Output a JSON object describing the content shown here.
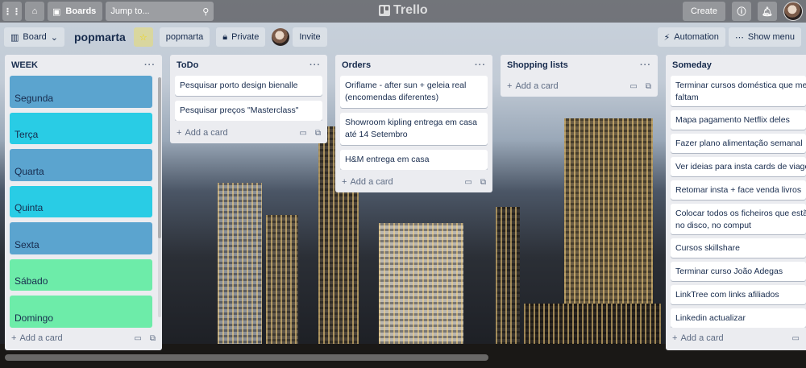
{
  "topbar": {
    "boards_label": "Boards",
    "search_placeholder": "Jump to...",
    "logo_text": "Trello",
    "create_label": "Create"
  },
  "board": {
    "view_label": "Board",
    "name": "popmarta",
    "workspace_label": "popmarta",
    "visibility_label": "Private",
    "invite_label": "Invite",
    "automation_label": "Automation",
    "show_menu_label": "Show menu"
  },
  "colors": {
    "blue_card": "#5ba4cf",
    "sky_card": "#29cce5",
    "green_card": "#6deca9",
    "list_bg": "#ebecf0"
  },
  "lists": [
    {
      "title": "WEEK",
      "add_label": "Add a card",
      "cards": [
        {
          "title": "Segunda",
          "color": "#5ba4cf"
        },
        {
          "title": "Terça",
          "color": "#29cce5"
        },
        {
          "title": "Quarta",
          "color": "#5ba4cf"
        },
        {
          "title": "Quinta",
          "color": "#29cce5"
        },
        {
          "title": "Sexta",
          "color": "#5ba4cf"
        },
        {
          "title": "Sábado",
          "color": "#6deca9"
        },
        {
          "title": "Domingo",
          "color": "#6deca9"
        }
      ]
    },
    {
      "title": "ToDo",
      "add_label": "Add a card",
      "cards": [
        {
          "title": "Pesquisar porto design bienalle"
        },
        {
          "title": "Pesquisar preços \"Masterclass\""
        }
      ]
    },
    {
      "title": "Orders",
      "add_label": "Add a card",
      "cards": [
        {
          "title": "Oriflame - after sun + geleia real (encomendas diferentes)"
        },
        {
          "title": "Showroom kipling entrega em casa até 14 Setembro"
        },
        {
          "title": "H&M entrega em casa"
        }
      ]
    },
    {
      "title": "Shopping lists",
      "add_label": "Add a card",
      "cards": []
    },
    {
      "title": "Someday",
      "add_label": "Add a card",
      "cards": [
        {
          "title": "Terminar cursos doméstica que me faltam"
        },
        {
          "title": "Mapa pagamento Netflix deles"
        },
        {
          "title": "Fazer plano alimentação semanal"
        },
        {
          "title": "Ver ideias para insta cards de viagem"
        },
        {
          "title": "Retomar insta + face venda livros"
        },
        {
          "title": "Colocar todos os ficheiros que estão no disco, no comput"
        },
        {
          "title": "Cursos skillshare"
        },
        {
          "title": "Terminar curso João Adegas"
        },
        {
          "title": "LinkTree com links afiliados"
        },
        {
          "title": "Linkedin actualizar"
        }
      ]
    }
  ]
}
